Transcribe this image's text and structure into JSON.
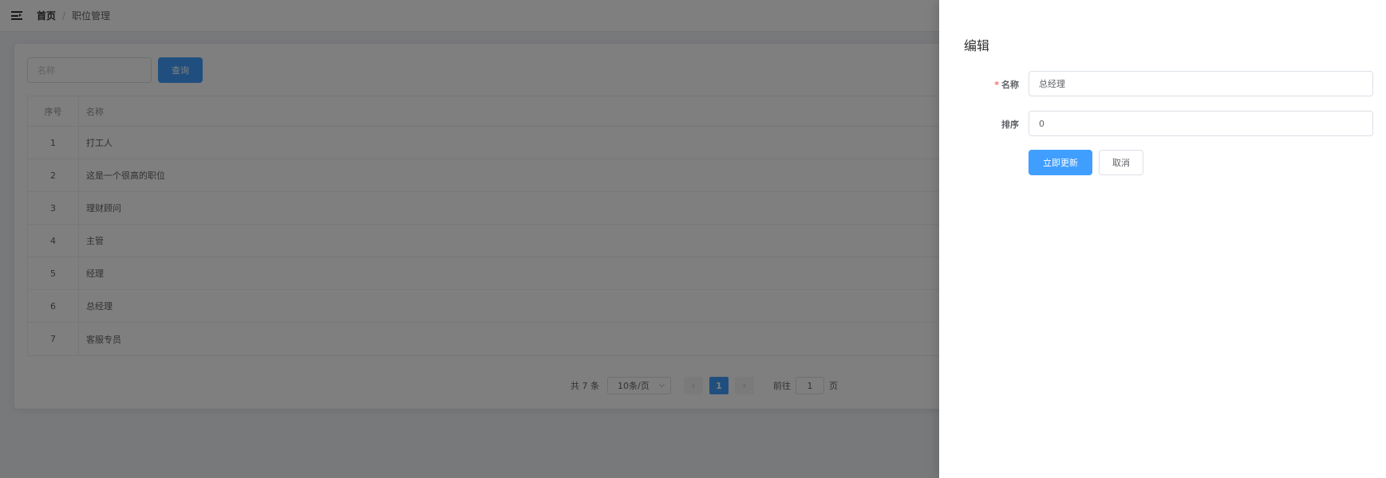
{
  "header": {
    "menu_icon": "menu-fold-icon",
    "breadcrumb": {
      "home": "首页",
      "separator": "/",
      "current": "职位管理"
    }
  },
  "search": {
    "placeholder": "名称",
    "value": "",
    "query_label": "查询"
  },
  "table": {
    "columns": [
      "序号",
      "名称"
    ],
    "rows": [
      {
        "index": "1",
        "name": "打工人"
      },
      {
        "index": "2",
        "name": "这是一个很高的职位"
      },
      {
        "index": "3",
        "name": "理财顾问"
      },
      {
        "index": "4",
        "name": "主管"
      },
      {
        "index": "5",
        "name": "经理"
      },
      {
        "index": "6",
        "name": "总经理"
      },
      {
        "index": "7",
        "name": "客服专员"
      }
    ]
  },
  "pagination": {
    "total_text": "共 7 条",
    "page_size": "10条/页",
    "prev_icon": "chevron-left-icon",
    "next_icon": "chevron-right-icon",
    "current_page": "1",
    "goto_prefix": "前往",
    "goto_value": "1",
    "goto_suffix": "页"
  },
  "drawer": {
    "title": "编辑",
    "fields": {
      "name": {
        "label": "名称",
        "required_mark": "*",
        "value": "总经理"
      },
      "sort": {
        "label": "排序",
        "value": "0"
      }
    },
    "submit_label": "立即更新",
    "cancel_label": "取消"
  },
  "colors": {
    "primary": "#409eff",
    "required": "#f56c6c",
    "overlay": "rgba(0,0,0,0.5)"
  }
}
